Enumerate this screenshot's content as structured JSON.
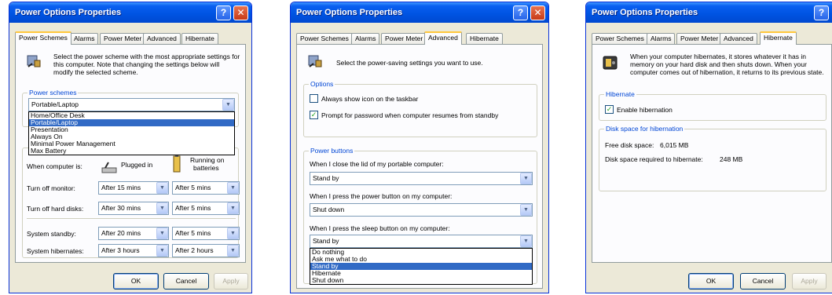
{
  "window1": {
    "title": "Power Options Properties",
    "tabs": [
      "Power Schemes",
      "Alarms",
      "Power Meter",
      "Advanced",
      "Hibernate"
    ],
    "description": "Select the power scheme with the most appropriate settings for this computer. Note that changing the settings below will modify the selected scheme.",
    "schemes_legend": "Power schemes",
    "schemes_value": "Portable/Laptop",
    "scheme_options": [
      "Home/Office Desk",
      "Portable/Laptop",
      "Presentation",
      "Always On",
      "Minimal Power Management",
      "Max Battery"
    ],
    "when_computer_is": "When computer is:",
    "plugged_in": "Plugged in",
    "running_on_batteries_1": "Running on",
    "running_on_batteries_2": "batteries",
    "rows": [
      {
        "label": "Turn off monitor:",
        "plugged": "After 15 mins",
        "battery": "After 5 mins"
      },
      {
        "label": "Turn off hard disks:",
        "plugged": "After 30 mins",
        "battery": "After 5 mins"
      },
      {
        "label": "System standby:",
        "plugged": "After 20 mins",
        "battery": "After 5 mins"
      },
      {
        "label": "System hibernates:",
        "plugged": "After 3 hours",
        "battery": "After 2 hours"
      }
    ],
    "ok": "OK",
    "cancel": "Cancel",
    "apply": "Apply"
  },
  "window2": {
    "title": "Power Options Properties",
    "tabs": [
      "Power Schemes",
      "Alarms",
      "Power Meter",
      "Advanced",
      "Hibernate"
    ],
    "description": "Select the power-saving settings you want to use.",
    "options_legend": "Options",
    "opt_show_icon": "Always show icon on the taskbar",
    "opt_prompt": "Prompt for password when computer resumes from standby",
    "buttons_legend": "Power buttons",
    "lid_label": "When I close the lid of my portable computer:",
    "lid_value": "Stand by",
    "power_label": "When I press the power button on my computer:",
    "power_value": "Shut down",
    "sleep_label": "When I press the sleep button on my computer:",
    "sleep_value": "Stand by",
    "sleep_options": [
      "Do nothing",
      "Ask me what to do",
      "Stand by",
      "Hibernate",
      "Shut down"
    ]
  },
  "window3": {
    "title": "Power Options Properties",
    "tabs": [
      "Power Schemes",
      "Alarms",
      "Power Meter",
      "Advanced",
      "Hibernate"
    ],
    "description": "When your computer hibernates, it stores whatever it has in memory on your hard disk and then shuts down. When your computer comes out of hibernation, it returns to its previous state.",
    "hibernate_legend": "Hibernate",
    "enable_hibernation": "Enable hibernation",
    "disk_legend": "Disk space for hibernation",
    "free_label": "Free disk space:",
    "free_value": "6,015 MB",
    "required_label": "Disk space required to hibernate:",
    "required_value": "248 MB",
    "ok": "OK",
    "cancel": "Cancel",
    "apply": "Apply"
  },
  "colors": {
    "title_blue": "#0054e3",
    "face": "#ece9d8",
    "selection": "#316ac5",
    "legend_blue": "#0046d5",
    "tab_accent": "#ffc73c"
  }
}
